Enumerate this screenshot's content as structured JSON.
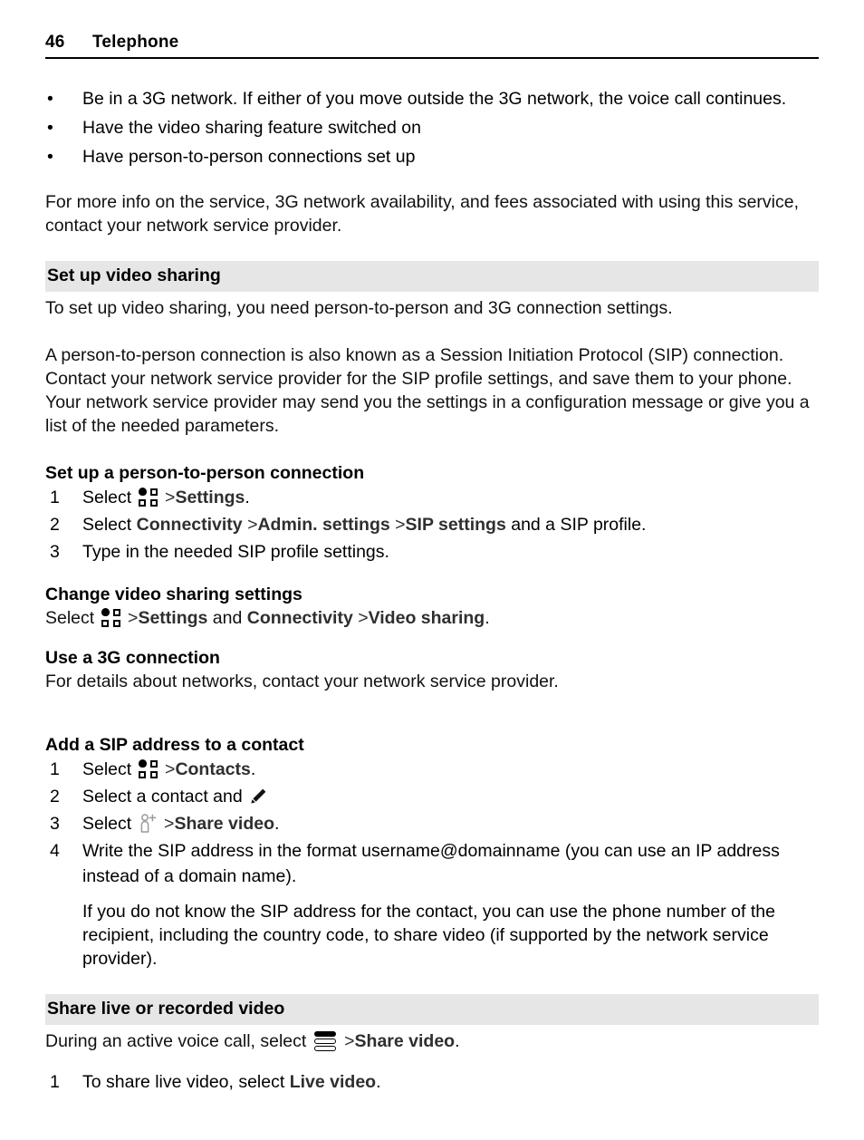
{
  "header": {
    "page_number": "46",
    "chapter": "Telephone"
  },
  "requirements_bullets": [
    {
      "mark": "•",
      "text": "Be in a 3G network. If either of you move outside the 3G network, the voice call continues."
    },
    {
      "mark": "•",
      "text": "Have the video sharing feature switched on"
    },
    {
      "mark": "•",
      "text": "Have person-to-person connections set up"
    }
  ],
  "intro_paragraph": "For more info on the service, 3G network availability, and fees associated with using this service, contact your network service provider.",
  "section_setup": {
    "heading": "Set up video sharing",
    "para1": "To set up video sharing, you need person-to-person and 3G connection settings.",
    "para2": "A person-to-person connection is also known as a Session Initiation Protocol (SIP) connection. Contact your network service provider for the SIP profile settings, and save them to your phone. Your network service provider may send you the settings in a configuration message or give you a list of the needed parameters."
  },
  "section_p2p": {
    "heading": "Set up a person-to-person connection",
    "step1": {
      "num": "1",
      "select_label": "Select",
      "icon": "menu-grid-icon",
      "separator": ">",
      "bold_target": "Settings",
      "trailing": "."
    },
    "step2": {
      "num": "2",
      "select_label": "Select",
      "bold1": "Connectivity",
      "sep1": ">",
      "bold2": "Admin. settings",
      "sep2": ">",
      "bold3": "SIP settings",
      "trailing": "and a SIP profile."
    },
    "step3": {
      "num": "3",
      "text": "Type in the needed SIP profile settings."
    }
  },
  "section_change": {
    "heading": "Change video sharing settings",
    "select_label": "Select",
    "icon": "menu-grid-icon",
    "sep1": ">",
    "bold1": "Settings",
    "mid": "and",
    "bold2": "Connectivity",
    "sep2": ">",
    "bold3": "Video sharing",
    "trailing": "."
  },
  "section_3g": {
    "heading": "Use a 3G connection",
    "para": "For details about networks, contact your network service provider."
  },
  "section_sip_contact": {
    "heading": "Add a SIP address to a contact",
    "step1": {
      "num": "1",
      "select_label": "Select",
      "icon": "menu-grid-icon",
      "separator": ">",
      "bold_target": "Contacts",
      "trailing": "."
    },
    "step2": {
      "num": "2",
      "text": "Select a contact and",
      "icon": "pencil-edit-icon"
    },
    "step3": {
      "num": "3",
      "select_label": "Select",
      "icon": "add-contact-icon",
      "separator": ">",
      "bold_target": "Share video",
      "trailing": "."
    },
    "step4": {
      "num": "4",
      "text": "Write the SIP address in the format username@domainname (you can use an IP address instead of a domain name).",
      "note": "If you do not know the SIP address for the contact, you can use the phone number of the recipient, including the country code, to share video (if supported by the network service provider)."
    }
  },
  "section_share": {
    "heading": "Share live or recorded video",
    "lead_prefix": "During an active voice call, select",
    "icon": "options-menu-icon",
    "separator": ">",
    "bold_target": "Share video",
    "trailing": ".",
    "step1": {
      "num": "1",
      "prefix": "To share live video, select",
      "bold_target": "Live video",
      "trailing": "."
    }
  },
  "colors": {
    "heading_shade": "#e6e6e6",
    "text": "#111111",
    "bold_text": "#2f2f2f",
    "rule": "#000000"
  }
}
